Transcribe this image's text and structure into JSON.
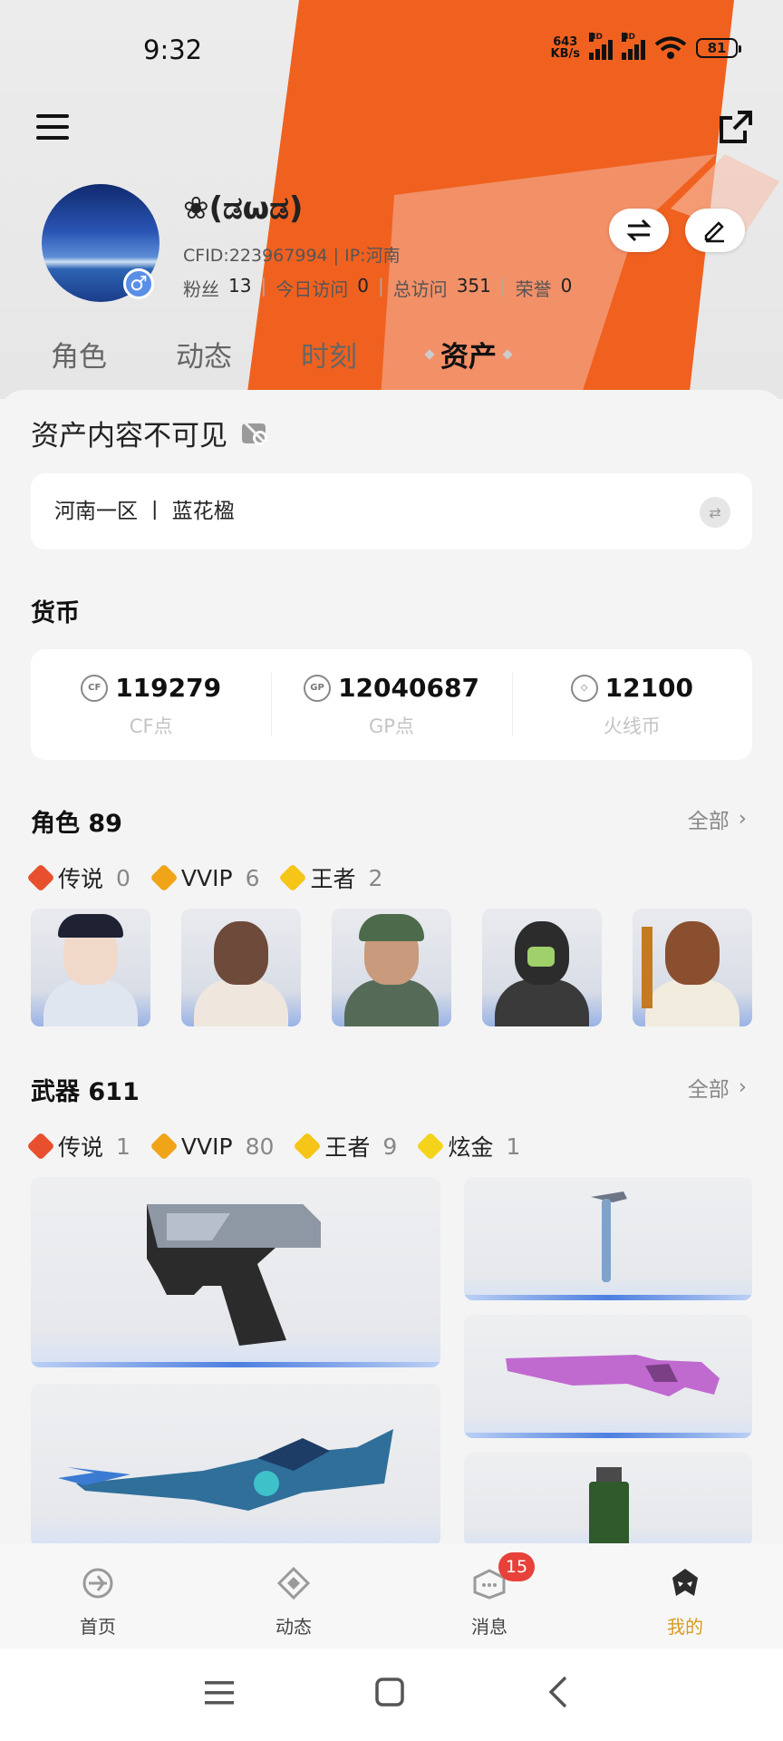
{
  "status_bar": {
    "time": "9:32",
    "net_speed": "643",
    "net_unit": "KB/s",
    "hd": "HD",
    "battery": "81"
  },
  "profile": {
    "nickname": "❀(ಡωಡ)",
    "cfid_line": "CFID:223967994 | IP:河南",
    "stats": {
      "fans_label": "粉丝",
      "fans": "13",
      "today_label": "今日访问",
      "today": "0",
      "total_label": "总访问",
      "total": "351",
      "honor_label": "荣誉",
      "honor": "0"
    },
    "gender": "♂"
  },
  "tabs": [
    "角色",
    "动态",
    "时刻",
    "资产"
  ],
  "assets": {
    "invisible_title": "资产内容不可见",
    "server": "河南一区 丨 蓝花楹",
    "currency_title": "货币",
    "currencies": [
      {
        "icon": "CF",
        "value": "119279",
        "label": "CF点"
      },
      {
        "icon": "GP",
        "value": "12040687",
        "label": "GP点"
      },
      {
        "icon": "◇",
        "value": "12100",
        "label": "火线币"
      }
    ],
    "roles": {
      "title": "角色 89",
      "all": "全部",
      "rarities": [
        {
          "name": "传说",
          "count": "0",
          "color": "#e8502d"
        },
        {
          "name": "VVIP",
          "count": "6",
          "color": "#f0a417"
        },
        {
          "name": "王者",
          "count": "2",
          "color": "#f5c518"
        }
      ]
    },
    "weapons": {
      "title": "武器 611",
      "all": "全部",
      "rarities": [
        {
          "name": "传说",
          "count": "1",
          "color": "#e8502d"
        },
        {
          "name": "VVIP",
          "count": "80",
          "color": "#f0a417"
        },
        {
          "name": "王者",
          "count": "9",
          "color": "#f5c518"
        },
        {
          "name": "炫金",
          "count": "1",
          "color": "#f5d31a"
        }
      ]
    }
  },
  "bottom_nav": [
    {
      "label": "首页"
    },
    {
      "label": "动态"
    },
    {
      "label": "消息",
      "badge": "15"
    },
    {
      "label": "我的"
    }
  ],
  "colors": {
    "accent_orange": "#f0561e",
    "active_nav": "#d99a1f",
    "badge_red": "#e8413a"
  }
}
